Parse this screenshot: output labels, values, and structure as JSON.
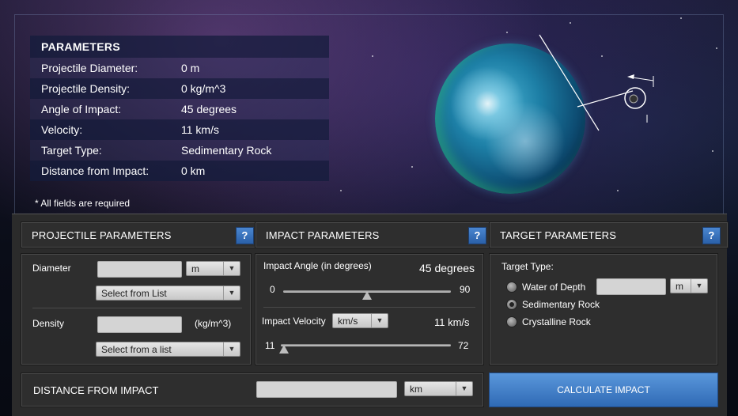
{
  "parameters": {
    "title": "PARAMETERS",
    "rows": [
      {
        "label": "Projectile Diameter:",
        "value": "0 m"
      },
      {
        "label": "Projectile Density:",
        "value": "0 kg/m^3"
      },
      {
        "label": "Angle of Impact:",
        "value": "45 degrees"
      },
      {
        "label": "Velocity:",
        "value": "11 km/s"
      },
      {
        "label": "Target Type:",
        "value": "Sedimentary Rock"
      },
      {
        "label": "Distance from Impact:",
        "value": "0 km"
      }
    ],
    "note": "* All fields are required"
  },
  "projectile": {
    "title": "PROJECTILE PARAMETERS",
    "help": "?",
    "diameter_label": "Diameter",
    "diameter_unit": "m",
    "diameter_select": "Select from List",
    "density_label": "Density",
    "density_unit": "(kg/m^3)",
    "density_select": "Select from a list"
  },
  "impact": {
    "title": "IMPACT PARAMETERS",
    "help": "?",
    "angle_label": "Impact Angle (in degrees)",
    "angle_value": "45 degrees",
    "angle_min": "0",
    "angle_max": "90",
    "angle_level": 0.5,
    "velocity_label": "Impact Velocity",
    "velocity_unit": "km/s",
    "velocity_value": "11 km/s",
    "velocity_min": "11",
    "velocity_max": "72",
    "velocity_level": 0.0
  },
  "target": {
    "title": "TARGET PARAMETERS",
    "help": "?",
    "type_label": "Target Type:",
    "options": [
      "Water of Depth",
      "Sedimentary Rock",
      "Crystalline Rock"
    ],
    "selected": "Sedimentary Rock",
    "depth_unit": "m"
  },
  "distance": {
    "label": "DISTANCE FROM IMPACT",
    "unit": "km"
  },
  "calculate_label": "CALCULATE IMPACT",
  "colors": {
    "accent": "#3f7fca",
    "panel": "#2e2e2e",
    "header_band": "#141c3c"
  },
  "icons": [
    "help-icon",
    "chevron-down-icon",
    "planet-illustration",
    "asteroid-icon"
  ]
}
